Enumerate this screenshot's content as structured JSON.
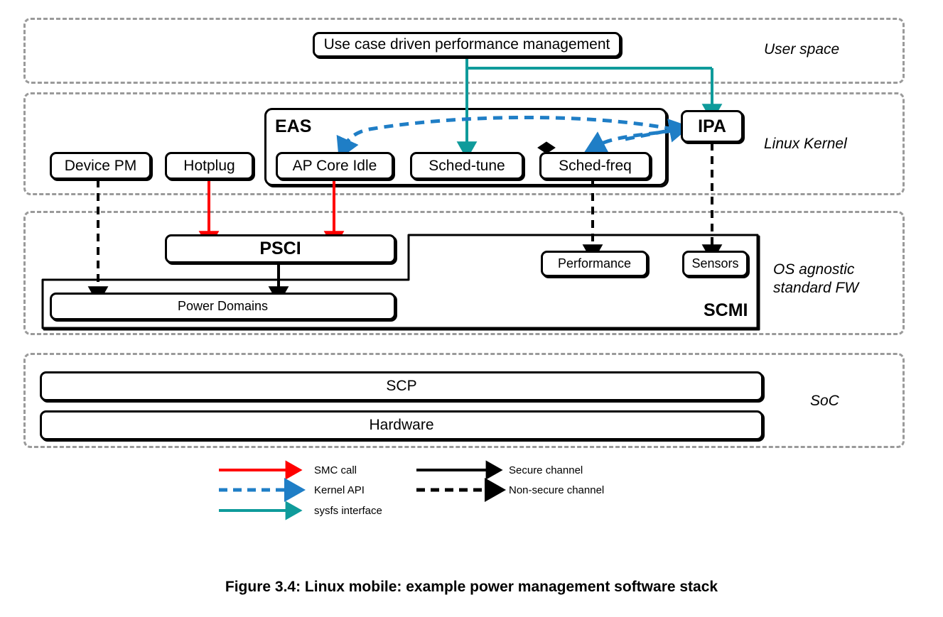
{
  "figure": {
    "caption": "Figure 3.4: Linux mobile: example power management software stack"
  },
  "layers": [
    {
      "id": "user-space",
      "label": "User space"
    },
    {
      "id": "linux-kernel",
      "label": "Linux Kernel"
    },
    {
      "id": "os-agnostic",
      "label": "OS agnostic\nstandard FW"
    },
    {
      "id": "soc",
      "label": "SoC"
    }
  ],
  "nodes": {
    "use_case": "Use case driven performance management",
    "eas": "EAS",
    "ipa": "IPA",
    "device_pm": "Device PM",
    "hotplug": "Hotplug",
    "ap_core_idle": "AP Core Idle",
    "sched_tune": "Sched-tune",
    "sched_freq": "Sched-freq",
    "psci": "PSCI",
    "scmi": "SCMI",
    "power_domains": "Power Domains",
    "performance": "Performance",
    "sensors": "Sensors",
    "scp": "SCP",
    "hardware": "Hardware"
  },
  "legend": {
    "items": [
      {
        "label": "SMC call",
        "style": "solid",
        "color": "#ff0000"
      },
      {
        "label": "Kernel API",
        "style": "dashed",
        "color": "#1f7ec6"
      },
      {
        "label": "sysfs interface",
        "style": "solid",
        "color": "#0f9b9b"
      },
      {
        "label": "Secure channel",
        "style": "solid",
        "color": "#000000"
      },
      {
        "label": "Non-secure channel",
        "style": "dashed",
        "color": "#000000"
      }
    ]
  },
  "colors": {
    "smc_red": "#ff0000",
    "kernel_api_blue": "#1f7ec6",
    "sysfs_teal": "#0f9b9b",
    "channel_black": "#000000",
    "layer_dash_gray": "#9a9a9a"
  }
}
